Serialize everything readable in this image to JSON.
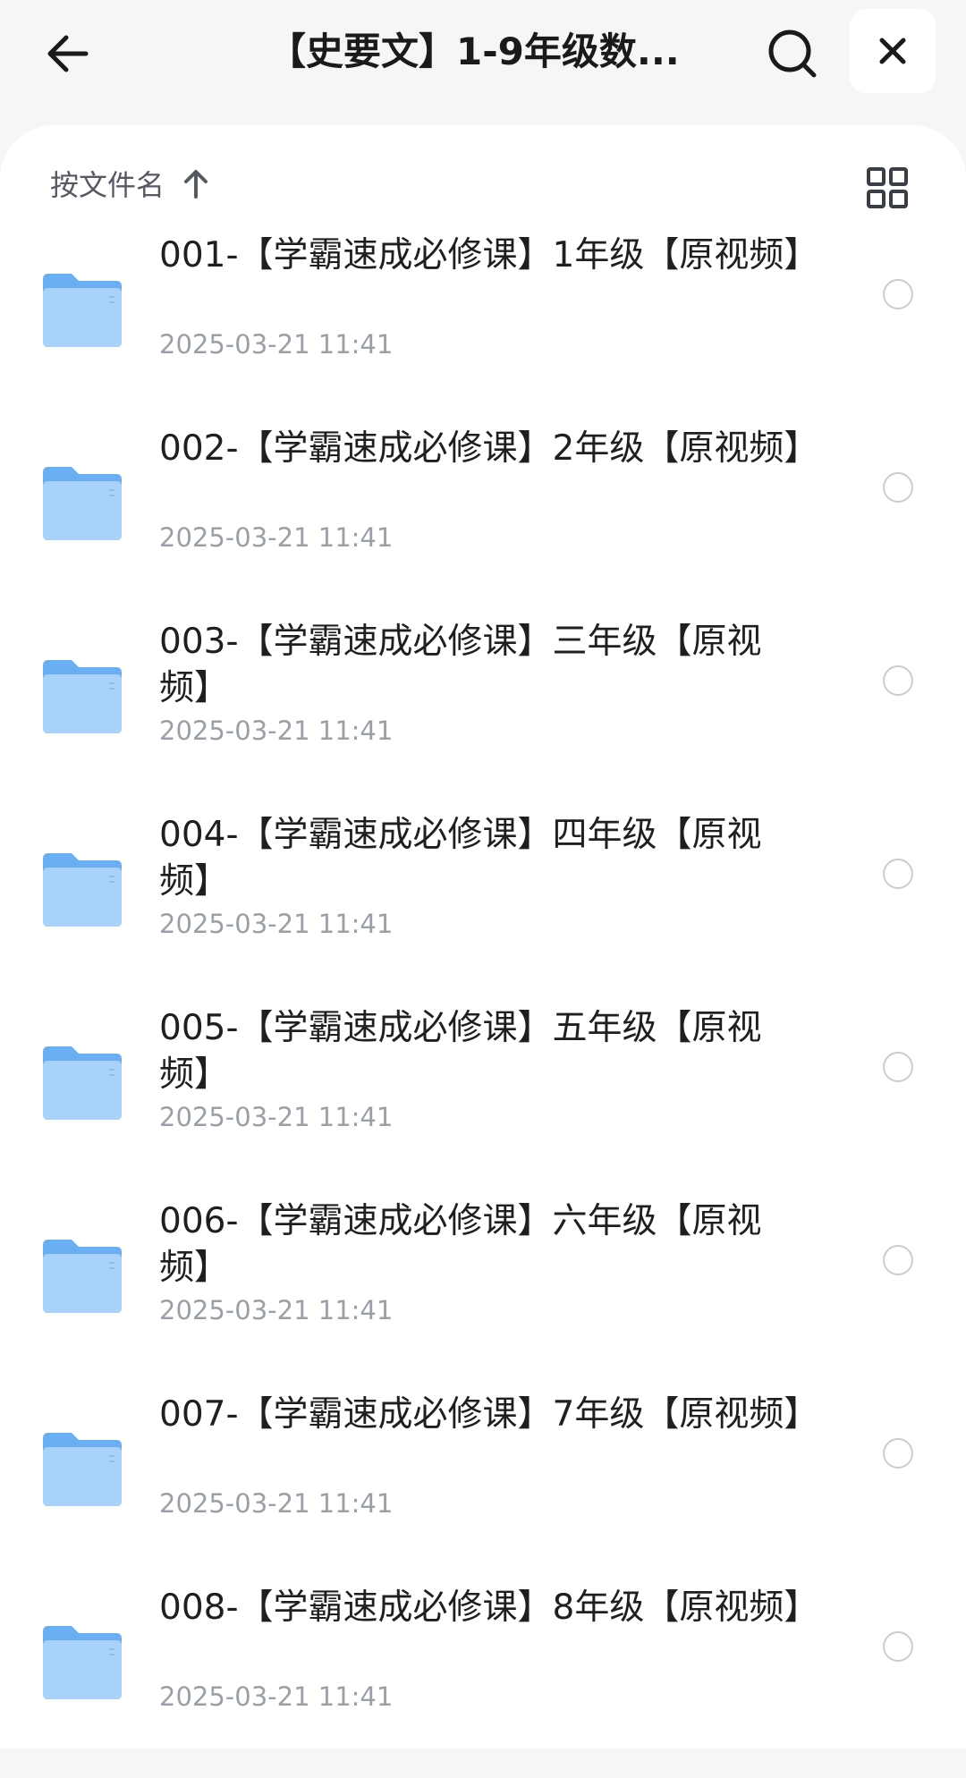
{
  "header": {
    "title": "【史要文】1-9年级数...",
    "back_icon": "arrow-left-icon",
    "search_icon": "search-icon",
    "close_icon": "close-icon"
  },
  "sort": {
    "label": "按文件名",
    "direction_icon": "arrow-up-icon",
    "view_icon": "grid-view-icon"
  },
  "colors": {
    "folder": "#6aaef3",
    "folder_light": "#a9d2fb",
    "date": "#9aa0a8"
  },
  "files": [
    {
      "name": "001-【学霸速成必修课】1年级【原视频】",
      "date": "2025-03-21 11:41"
    },
    {
      "name": "002-【学霸速成必修课】2年级【原视频】",
      "date": "2025-03-21 11:41"
    },
    {
      "name": "003-【学霸速成必修课】三年级【原视频】",
      "date": "2025-03-21 11:41"
    },
    {
      "name": "004-【学霸速成必修课】四年级【原视频】",
      "date": "2025-03-21 11:41"
    },
    {
      "name": "005-【学霸速成必修课】五年级【原视频】",
      "date": "2025-03-21 11:41"
    },
    {
      "name": "006-【学霸速成必修课】六年级【原视频】",
      "date": "2025-03-21 11:41"
    },
    {
      "name": "007-【学霸速成必修课】7年级【原视频】",
      "date": "2025-03-21 11:41"
    },
    {
      "name": "008-【学霸速成必修课】8年级【原视频】",
      "date": "2025-03-21 11:41"
    }
  ]
}
